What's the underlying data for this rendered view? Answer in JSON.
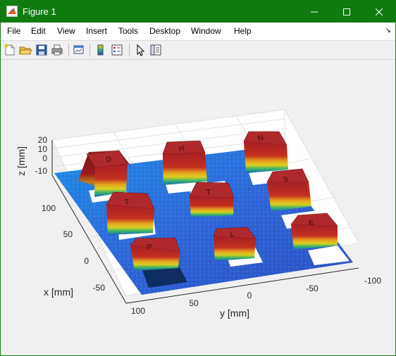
{
  "window": {
    "title": "Figure 1"
  },
  "menu": {
    "items": [
      {
        "label": "File"
      },
      {
        "label": "Edit"
      },
      {
        "label": "View"
      },
      {
        "label": "Insert"
      },
      {
        "label": "Tools"
      },
      {
        "label": "Desktop"
      },
      {
        "label": "Window"
      },
      {
        "label": "Help"
      }
    ],
    "corner_glyph": "↘"
  },
  "toolbar": {
    "icons": [
      "new-figure-icon",
      "open-file-icon",
      "save-icon",
      "print-icon",
      "link-plot-icon",
      "insert-colorbar-icon",
      "insert-legend-icon",
      "edit-plot-icon",
      "property-inspector-icon"
    ]
  },
  "chart_data": {
    "type": "surface",
    "description_visible": "3D surface scan of blocks with letters on a plane",
    "xlabel": "x [mm]",
    "ylabel": "y [mm]",
    "zlabel": "z [mm]",
    "x_ticks": [
      "100",
      "50",
      "0",
      "-50"
    ],
    "y_ticks": [
      "100",
      "50",
      "0",
      "-50",
      "-100"
    ],
    "z_ticks": [
      "20",
      "10",
      "0",
      "-10"
    ],
    "colors": {
      "plane": "#2a6fd8",
      "block_top": "#b0242a",
      "block_mid": "#e8d020",
      "block_low": "#2fb070"
    }
  }
}
